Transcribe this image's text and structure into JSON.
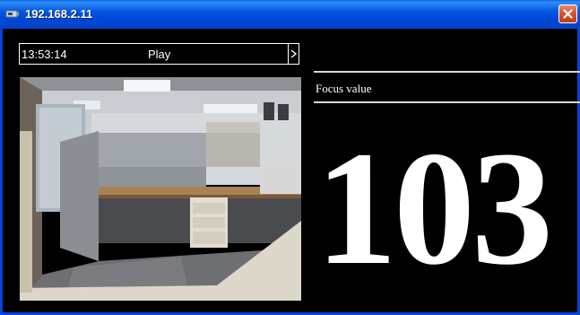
{
  "window": {
    "title": "192.168.2.11"
  },
  "playback": {
    "time": "13:53:14",
    "status": "Play"
  },
  "focus": {
    "label": "Focus value",
    "value": "103"
  },
  "colors": {
    "titlebar": "#0058e0",
    "close": "#d9542c",
    "background": "#000000",
    "text": "#ffffff"
  }
}
